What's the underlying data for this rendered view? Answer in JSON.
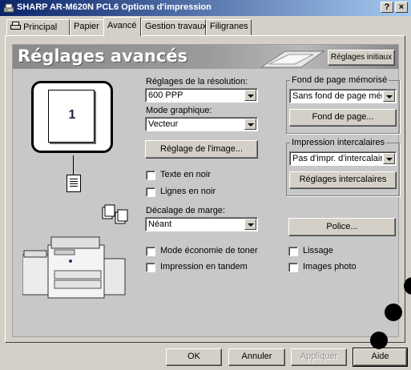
{
  "window": {
    "title": "SHARP AR-M620N PCL6 Options d'impression",
    "help_btn": "?",
    "close_btn": "×"
  },
  "tabs": [
    "Principal",
    "Papier",
    "Avancé",
    "Gestion travaux",
    "Filigranes"
  ],
  "banner": {
    "title": "Réglages avancés",
    "defaults_button": "Réglages initiaux"
  },
  "preview": {
    "page_number": "1"
  },
  "resolution": {
    "label": "Réglages de la résolution:",
    "value": "600 PPP"
  },
  "graphics_mode": {
    "label": "Mode graphique:",
    "value": "Vecteur"
  },
  "image_settings_button": "Réglage de l'image...",
  "checkboxes": {
    "text_black": "Texte en noir",
    "lines_black": "Lignes en noir",
    "toner_save": "Mode économie de toner",
    "tandem": "Impression en tandem",
    "smoothing": "Lissage",
    "photo_images": "Images photo"
  },
  "margin_shift": {
    "label": "Décalage de marge:",
    "value": "Néant"
  },
  "stored_overlay": {
    "group_title": "Fond de page mémorisé",
    "value": "Sans fond de page mémo.",
    "button": "Fond de page..."
  },
  "insert_printing": {
    "group_title": "Impression intercalaires",
    "value": "Pas d'impr. d'intercalaires",
    "button": "Réglages intercalaires"
  },
  "font_button": "Police...",
  "footer": {
    "ok": "OK",
    "cancel": "Annuler",
    "apply": "Appliquer",
    "help": "Aide"
  }
}
